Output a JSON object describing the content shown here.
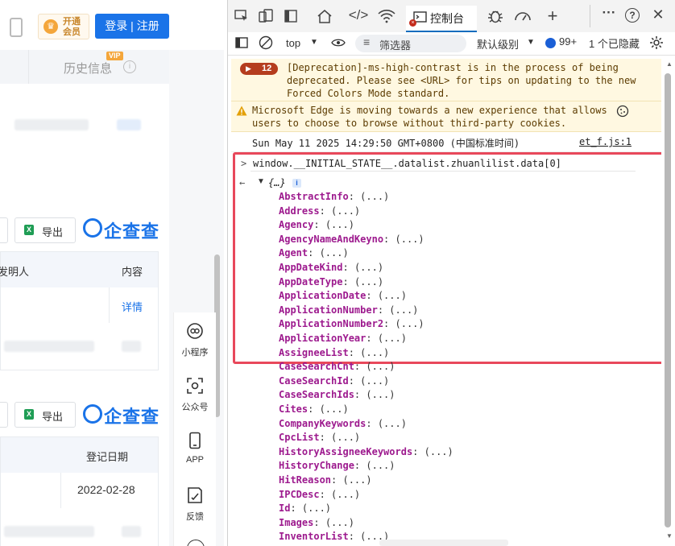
{
  "left_page": {
    "vip_button": {
      "line1": "开通",
      "line2": "会员"
    },
    "login_button": "登录 | 注册",
    "history_tab": "历史信息",
    "vip_tag": "VIP",
    "section1": {
      "export_label": "导出",
      "logo_text": "企查查",
      "table_headers": [
        "发明人",
        "内容"
      ],
      "row_link": "详情"
    },
    "section2": {
      "export_label": "导出",
      "logo_text": "企查查",
      "table_header": "登记日期",
      "row_date": "2022-02-28"
    },
    "side_menu": [
      {
        "label": "小程序",
        "icon": "mini-program-icon"
      },
      {
        "label": "公众号",
        "icon": "qr-scan-icon"
      },
      {
        "label": "APP",
        "icon": "phone-icon"
      },
      {
        "label": "反馈",
        "icon": "feedback-icon"
      }
    ]
  },
  "devtools": {
    "console_tab": "控制台",
    "context": "top",
    "filter_placeholder": "筛选器",
    "level": "默认级别",
    "issues_count": "99+",
    "hidden_count": "1 个已隐藏",
    "messages": {
      "deprecation_count": "12",
      "deprecation_text": "[Deprecation]-ms-high-contrast is in the process of being deprecated. Please see <URL> for tips on updating to the new Forced Colors Mode standard.",
      "edge_text": "Microsoft Edge is moving towards a new experience that allows users to choose to browse without third-party cookies.",
      "timestamp": "Sun May 11 2025 14:29:50 GMT+0800 (中国标准时间)",
      "source_link": "et_f.js:1",
      "command": "window.__INITIAL_STATE__.datalist.zhuanlilist.data[0]",
      "result_summary": "{…}",
      "info_badge": "i"
    },
    "properties": [
      "AbstractInfo",
      "Address",
      "Agency",
      "AgencyNameAndKeyno",
      "Agent",
      "AppDateKind",
      "AppDateType",
      "ApplicationDate",
      "ApplicationNumber",
      "ApplicationNumber2",
      "ApplicationYear",
      "AssigneeList",
      "CaseSearchCnt",
      "CaseSearchId",
      "CaseSearchIds",
      "Cites",
      "CompanyKeywords",
      "CpcList",
      "HistoryAssigneeKeywords",
      "HistoryChange",
      "HitReason",
      "IPCDesc",
      "Id",
      "Images",
      "InventorList"
    ],
    "prop_value": "(...)"
  }
}
